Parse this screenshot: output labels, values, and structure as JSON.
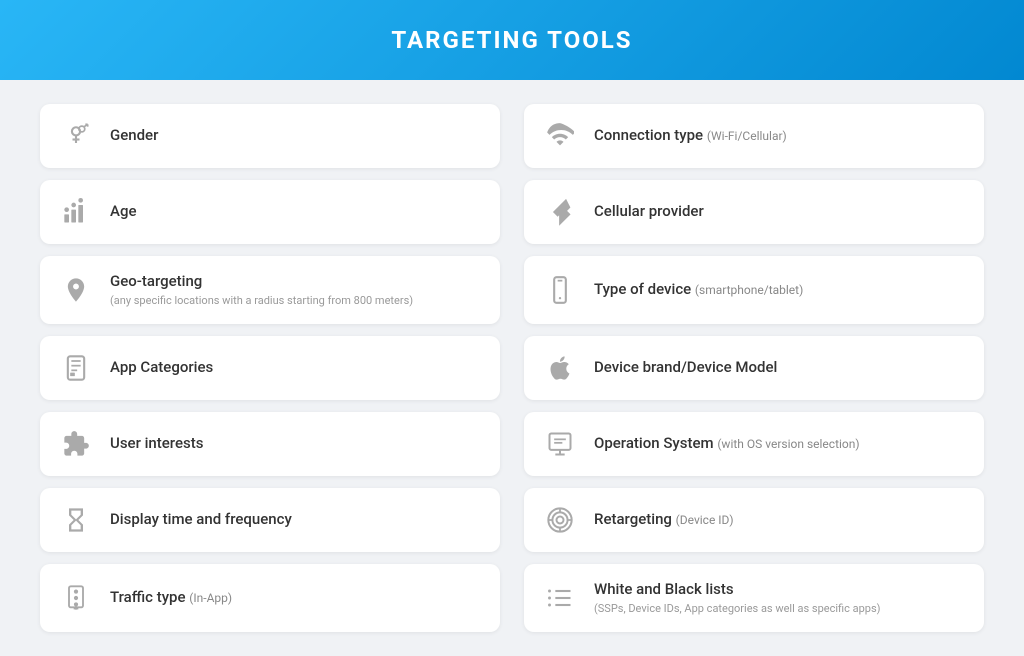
{
  "header": {
    "title": "TARGETING TOOLS"
  },
  "cards": {
    "left": [
      {
        "id": "gender",
        "label": "Gender",
        "sublabel": "",
        "icon": "gender"
      },
      {
        "id": "age",
        "label": "Age",
        "sublabel": "",
        "icon": "age"
      },
      {
        "id": "geo",
        "label": "Geo-targeting",
        "sublabel": "(any specific locations with a radius starting from 800 meters)",
        "icon": "geo"
      },
      {
        "id": "app-categories",
        "label": "App Categories",
        "sublabel": "",
        "icon": "app"
      },
      {
        "id": "user-interests",
        "label": "User interests",
        "sublabel": "",
        "icon": "puzzle"
      },
      {
        "id": "display-time",
        "label": "Display time and frequency",
        "sublabel": "",
        "icon": "hourglass"
      },
      {
        "id": "traffic-type",
        "label": "Traffic type",
        "label_small": "(In-App)",
        "sublabel": "",
        "icon": "traffic"
      }
    ],
    "right": [
      {
        "id": "connection-type",
        "label": "Connection type",
        "label_small": "(Wi-Fi/Cellular)",
        "sublabel": "",
        "icon": "wifi"
      },
      {
        "id": "cellular-provider",
        "label": "Cellular provider",
        "sublabel": "",
        "icon": "cellular"
      },
      {
        "id": "type-of-device",
        "label": "Type of device",
        "label_small": "(smartphone/tablet)",
        "sublabel": "",
        "icon": "phone"
      },
      {
        "id": "device-brand",
        "label": "Device brand/Device Model",
        "sublabel": "",
        "icon": "apple"
      },
      {
        "id": "operation-system",
        "label": "Operation System",
        "label_small": "(with OS version selection)",
        "sublabel": "",
        "icon": "os"
      },
      {
        "id": "retargeting",
        "label": "Retargeting",
        "label_small": "(Device ID)",
        "sublabel": "",
        "icon": "target"
      },
      {
        "id": "white-black-lists",
        "label": "White and Black lists",
        "sublabel": "(SSPs, Device IDs, App categories as well as specific apps)",
        "icon": "list"
      }
    ]
  }
}
